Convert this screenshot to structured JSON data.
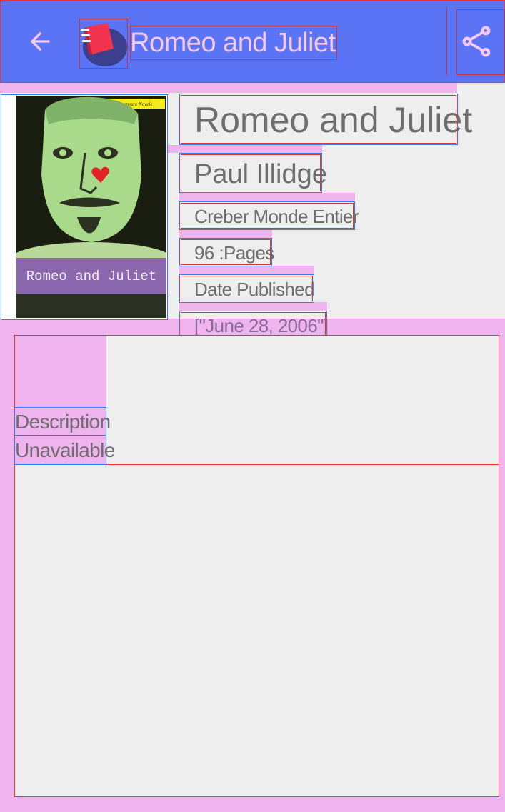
{
  "appbar": {
    "title": "Romeo and Juliet",
    "back_icon": "arrow-back-icon",
    "logo_icon": "book-logo-icon",
    "share_icon": "share-icon",
    "background_color": "#5b73f5",
    "title_color": "#f6c8f4"
  },
  "book": {
    "cover_series": "The Shakespeare Novels",
    "cover_title": "Romeo and Juliet",
    "title": "Romeo and Juliet",
    "author": "Paul Illidge",
    "publisher": "Creber Monde Entier",
    "pages": "96 :Pages",
    "date_label": "Date Published",
    "date_value": "[\"June 28, 2006\"]"
  },
  "description": {
    "line1": "Description",
    "line2": "Unavailable"
  },
  "colors": {
    "page_background": "#eeeeee",
    "overlay_pink": "#efb4ee",
    "text_gray": "#6e6e6e"
  }
}
